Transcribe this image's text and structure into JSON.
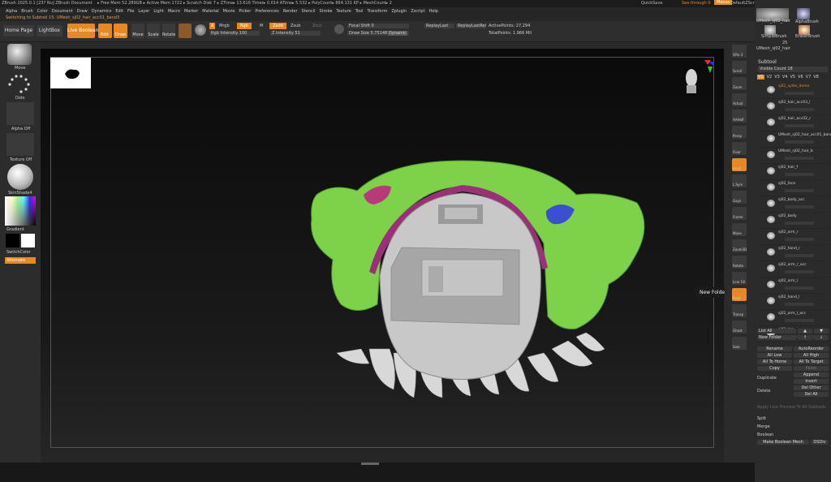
{
  "title_bar": {
    "left": "ZBrush 2025.0.1 [23? Nu]  ZBrush Document",
    "stats": "▸ Free Mem 52.289GB ▸ Active Mem 1722 ▸ Scratch Disk 7 ▸ ZTime▸ 13.616 Timer▸ 0.014 ATime▸ 5.532 ▸ PolyCount▸ 864.131 KP ▸ MeshCount▸ 2",
    "quicksave": "QuickSave",
    "see_through": "See-through 0",
    "menus_btn": "Menus",
    "script": "DefaultZScript"
  },
  "menu": [
    "Alpha",
    "Brush",
    "Color",
    "Document",
    "Draw",
    "Dynamics",
    "Edit",
    "File",
    "Layer",
    "Light",
    "Macro",
    "Marker",
    "Material",
    "Movie",
    "Picker",
    "Preferences",
    "Render",
    "Stencil",
    "Stroke",
    "Texture",
    "Tool",
    "Transform",
    "Zplugin",
    "Zscript",
    "Help"
  ],
  "note": "Switching to Subtool 15: UMesh_sj02_hair_acc01_band3",
  "shelf": {
    "home": "Home Page",
    "lightbox": "LightBox",
    "live_boolean": "Live Boolean",
    "edit": "Edit",
    "draw": "Draw",
    "move": "Move",
    "scale": "Scale",
    "rotate": "Rotate",
    "a": "A",
    "mrgb": "Mrgb",
    "rgb": "Rgb",
    "m": "M",
    "zadd": "Zadd",
    "zsub": "Zsub",
    "zcut": "Zcut",
    "rgb_intensity": "Rgb Intensity 100",
    "z_intensity": "Z Intensity 51",
    "focal_shift": "Focal Shift 0",
    "draw_size": "Draw Size 5.75148",
    "dynamic": "Dynamic",
    "replay_last": "ReplayLast",
    "replay_last_rel": "ReplayLastRel",
    "active_points": "ActivePoints: 27,294",
    "total_points": "TotalPoints: 1.966 Mil"
  },
  "left": {
    "brush": "Move",
    "stroke": "Dots",
    "alpha": "Alpha Off",
    "texture": "Texture Off",
    "material": "SkinShade4",
    "gradient": "Gradient",
    "switch": "SwitchColor",
    "alternate": "Alternate"
  },
  "rtool": [
    "SPix 3",
    "Scroll",
    "Zoom",
    "Actual",
    "AAHalf",
    "Persp",
    "Floor",
    "Local",
    "L.Sym",
    "Gxyz",
    "Frame",
    "Move",
    "Zoom3D",
    "Rotate",
    "Line Fill",
    "PolyF",
    "Transp",
    "Ghost",
    "Solo"
  ],
  "rpanel": {
    "top_items": [
      "UMesh_sj02_hair",
      "AlphaBrush",
      "SimpleBrush",
      "EraserBrush",
      "UMesh_sj02_hair"
    ],
    "num": "25",
    "subtool": "Subtool",
    "visible_count": "Visible Count 18",
    "versions": [
      "V1",
      "V2",
      "V3",
      "V4",
      "V5",
      "V6",
      "V7",
      "V8"
    ],
    "subtools": [
      "sj02_spike_dome",
      "sj02_hair_acc03_l",
      "sj02_hair_acc02_r",
      "UMesh_sj02_hair_acc01_band",
      "UMesh_sj02_hair_b",
      "sj02_hair_f",
      "sj02_face",
      "sj02_body_acc",
      "sj02_body",
      "sj02_arm_r",
      "sj02_hand_r",
      "sj02_arm_r_acc",
      "sj02_arm_l",
      "sj02_hand_l",
      "sj02_arm_l_acc",
      "sj02_leg"
    ],
    "list_all": "List All",
    "new_folder": "New Folder",
    "rename": "Rename",
    "autoreorder": "AutoReorder",
    "all_low": "All Low",
    "all_high": "All High",
    "all_to_home": "All To Home",
    "all_to_target": "All To Target",
    "copy": "Copy",
    "paste": "Paste",
    "append": "Append",
    "duplicate": "Duplicate",
    "insert": "Insert",
    "delete": "Delete",
    "del_other": "Del Other",
    "del_all": "Del All",
    "apply": "Apply Live Preview To All Subtools",
    "split": "Split",
    "merge": "Merge",
    "boolean": "Boolean",
    "make_boolean": "Make Boolean Mesh",
    "dsdiv": "DSDiv"
  },
  "tooltip": "New Folder  Ctrl+F",
  "colors": {
    "accent": "#e8891f",
    "hair": "#7ed24a",
    "interior": "#c8c8c8",
    "band": "#9b2f7a",
    "gem": "#3a4fd1"
  }
}
